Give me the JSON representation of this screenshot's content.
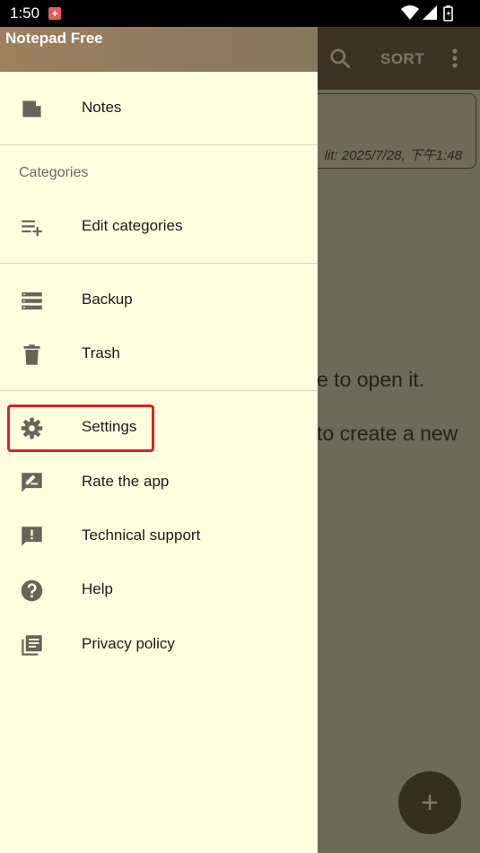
{
  "status_bar": {
    "time": "1:50"
  },
  "background": {
    "toolbar": {
      "sort_label": "SORT"
    },
    "note": {
      "meta": "lit: 2025/7/28, 下午1:48"
    },
    "hint_line1": "e to open it.",
    "hint_line2": "to create a new",
    "fab_label": "+"
  },
  "drawer": {
    "title": "Notepad Free",
    "items": [
      {
        "label": "Notes",
        "icon": "note-icon"
      },
      {
        "label": "Edit categories",
        "icon": "playlist-add-icon"
      },
      {
        "label": "Backup",
        "icon": "storage-icon"
      },
      {
        "label": "Trash",
        "icon": "trash-icon"
      },
      {
        "label": "Settings",
        "icon": "gear-icon"
      },
      {
        "label": "Rate the app",
        "icon": "rate-review-icon"
      },
      {
        "label": "Technical support",
        "icon": "feedback-icon"
      },
      {
        "label": "Help",
        "icon": "help-icon"
      },
      {
        "label": "Privacy policy",
        "icon": "library-books-icon"
      }
    ],
    "categories_header": "Categories"
  },
  "colors": {
    "drawer_bg": "#ffffe0",
    "toolbar_bg": "#3b3224",
    "icon_color": "#666657",
    "highlight": "#e02020"
  }
}
